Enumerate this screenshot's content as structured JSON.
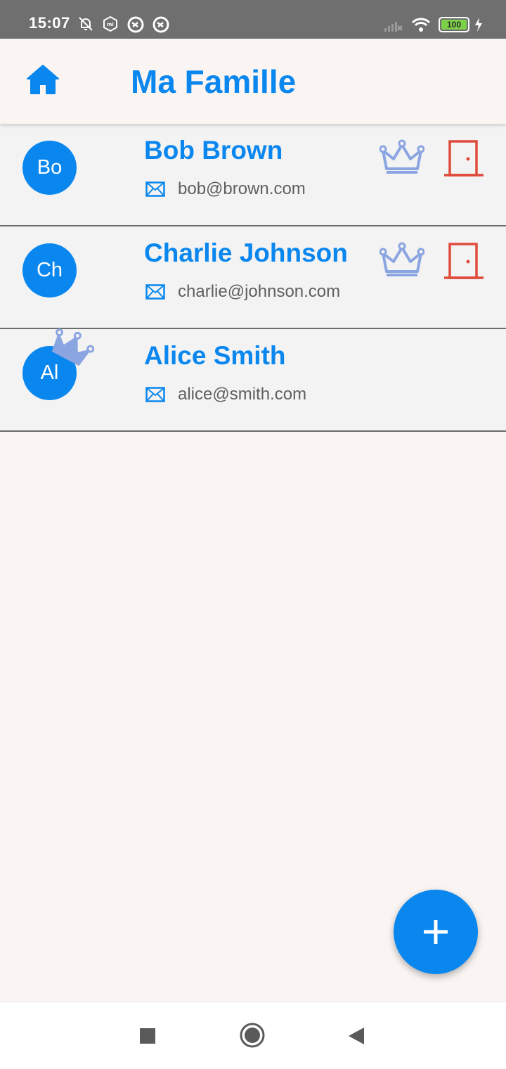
{
  "status_bar": {
    "time": "15:07",
    "battery": "100",
    "icons": [
      "bell-off-icon",
      "mi-icon",
      "sync-icon",
      "sync-icon",
      "signal-icon",
      "wifi-icon",
      "battery-icon",
      "charging-icon"
    ]
  },
  "app_bar": {
    "title": "Ma Famille",
    "home_icon": "home-icon"
  },
  "members": [
    {
      "initials": "Bo",
      "name": "Bob Brown",
      "email": "bob@brown.com",
      "show_actions": true,
      "is_owner": false
    },
    {
      "initials": "Ch",
      "name": "Charlie Johnson",
      "email": "charlie@johnson.com",
      "show_actions": true,
      "is_owner": false
    },
    {
      "initials": "Al",
      "name": "Alice Smith",
      "email": "alice@smith.com",
      "show_actions": false,
      "is_owner": true
    }
  ],
  "fab": {
    "label": "+"
  },
  "colors": {
    "accent": "#0a87ef",
    "crown": "#8aa5e0",
    "leave": "#e04a3b",
    "row_bg": "#f3f3f4",
    "page_bg": "#faf5f3"
  },
  "nav_bar": {
    "buttons": [
      "recents-square-icon",
      "home-circle-icon",
      "back-triangle-icon"
    ]
  }
}
